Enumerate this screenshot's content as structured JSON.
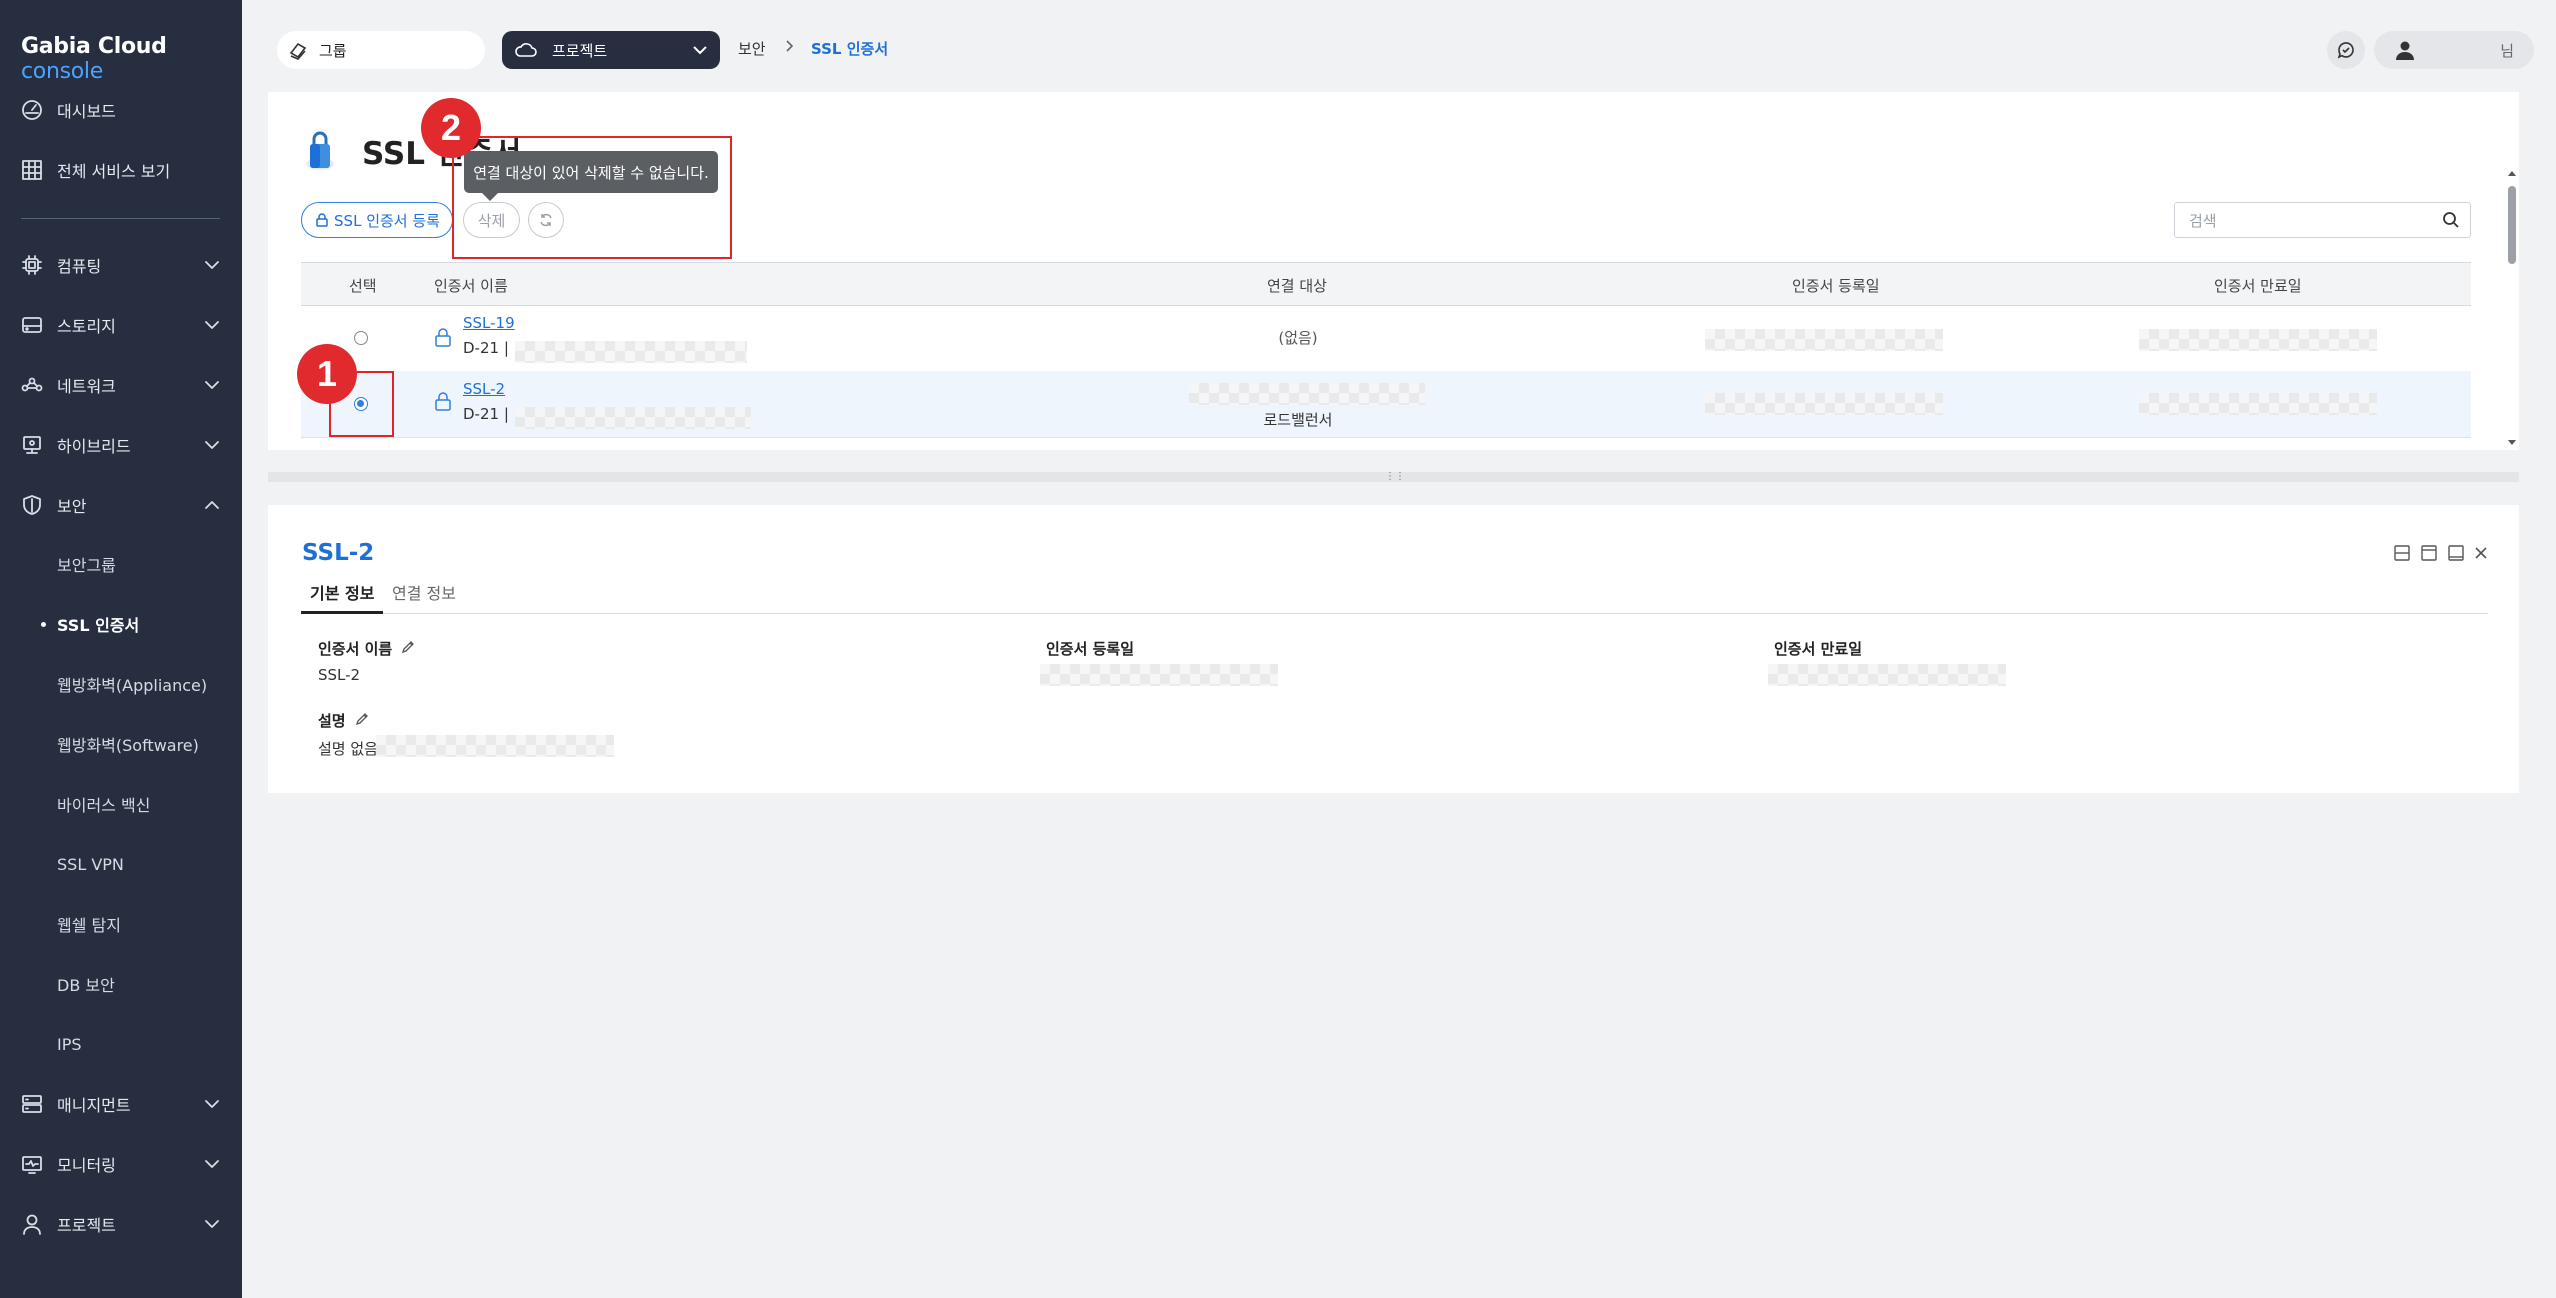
{
  "brand": {
    "name": "Gabia Cloud",
    "suffix": "console"
  },
  "sidebar": {
    "top_items": [
      {
        "label": "대시보드",
        "icon": "dashboard-icon"
      },
      {
        "label": "전체 서비스 보기",
        "icon": "grid-icon"
      }
    ],
    "sections": [
      {
        "label": "컴퓨팅",
        "icon": "cpu-icon",
        "expanded": false
      },
      {
        "label": "스토리지",
        "icon": "storage-icon",
        "expanded": false
      },
      {
        "label": "네트워크",
        "icon": "network-icon",
        "expanded": false
      },
      {
        "label": "하이브리드",
        "icon": "hybrid-icon",
        "expanded": false
      },
      {
        "label": "보안",
        "icon": "shield-icon",
        "expanded": true
      }
    ],
    "security_sub_items": [
      {
        "label": "보안그룹",
        "active": false
      },
      {
        "label": "SSL 인증서",
        "active": true
      },
      {
        "label": "웹방화벽(Appliance)",
        "active": false
      },
      {
        "label": "웹방화벽(Software)",
        "active": false
      },
      {
        "label": "바이러스 백신",
        "active": false
      },
      {
        "label": "SSL VPN",
        "active": false
      },
      {
        "label": "웹쉘 탐지",
        "active": false
      },
      {
        "label": "DB 보안",
        "active": false
      },
      {
        "label": "IPS",
        "active": false
      }
    ],
    "bottom_sections": [
      {
        "label": "매니지먼트",
        "icon": "server-icon"
      },
      {
        "label": "모니터링",
        "icon": "monitor-icon"
      },
      {
        "label": "프로젝트",
        "icon": "user-icon"
      }
    ]
  },
  "topbar": {
    "group_label": "그룹",
    "project_label": "프로젝트",
    "breadcrumb": [
      "보안",
      "SSL 인증서"
    ],
    "user_suffix": "님"
  },
  "list": {
    "title": "SSL 인증서",
    "register_button": "SSL 인증서 등록",
    "delete_button": "삭제",
    "tooltip": "연결 대상이 있어 삭제할 수 없습니다.",
    "search_placeholder": "검색",
    "columns": [
      "선택",
      "인증서 이름",
      "연결 대상",
      "인증서 등록일",
      "인증서 만료일"
    ],
    "rows": [
      {
        "name": "SSL-19",
        "days": "D-21 |",
        "target": "(없음)",
        "selected": false
      },
      {
        "name": "SSL-2",
        "days": "D-21 |",
        "target": "로드밸런서",
        "selected": true
      }
    ]
  },
  "detail": {
    "title": "SSL-2",
    "tabs": [
      "기본 정보",
      "연결 정보"
    ],
    "fields": {
      "name_label": "인증서 이름",
      "name_value": "SSL-2",
      "reg_label": "인증서 등록일",
      "exp_label": "인증서 만료일",
      "desc_label": "설명",
      "desc_value": "설명 없음"
    }
  },
  "annotations": {
    "badge_1": "1",
    "badge_2": "2"
  },
  "colors": {
    "sidebar_bg": "#262e3f",
    "accent": "#1f6fd8",
    "annotation": "#e0242a"
  }
}
